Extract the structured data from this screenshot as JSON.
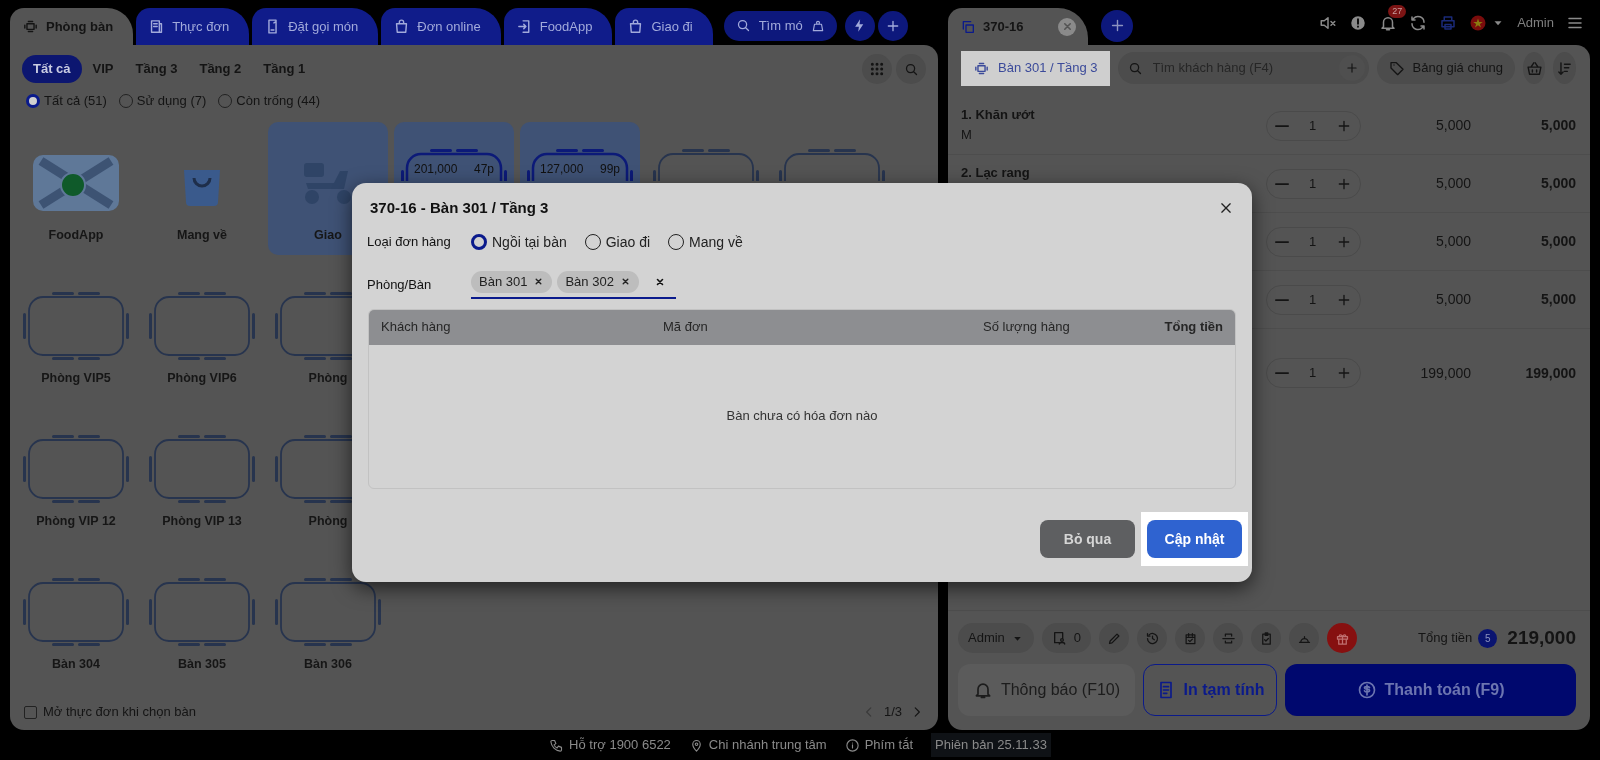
{
  "nav_tabs": [
    {
      "label": "Phòng bàn",
      "selected": true
    },
    {
      "label": "Thực đơn",
      "selected": false
    },
    {
      "label": "Đặt gọi món",
      "selected": false
    },
    {
      "label": "Đơn online",
      "selected": false
    },
    {
      "label": "FoodApp",
      "selected": false
    },
    {
      "label": "Giao đi",
      "selected": false
    }
  ],
  "menu_search": {
    "label": "Tìm mó"
  },
  "area_filters": [
    {
      "label": "Tất cả",
      "selected": true
    },
    {
      "label": "VIP",
      "selected": false
    },
    {
      "label": "Tầng 3",
      "selected": false
    },
    {
      "label": "Tầng 2",
      "selected": false
    },
    {
      "label": "Tầng 1",
      "selected": false
    }
  ],
  "status_filters": [
    {
      "label": "Tất cả (51)",
      "selected": true
    },
    {
      "label": "Sử dụng (7)",
      "selected": false
    },
    {
      "label": "Còn trống (44)",
      "selected": false
    }
  ],
  "table_grid": [
    [
      {
        "kind": "foodapp",
        "label": "FoodApp",
        "selected": false
      },
      {
        "kind": "takeaway",
        "label": "Mang về",
        "selected": false
      },
      {
        "kind": "delivery",
        "label": "Giao",
        "selected": true
      },
      {
        "kind": "table",
        "occupied": true,
        "amount": "201,000",
        "duration": "47p"
      },
      {
        "kind": "table",
        "occupied": true,
        "amount": "127,000",
        "duration": "99p"
      },
      {
        "kind": "table",
        "occupied": false
      },
      {
        "kind": "table",
        "occupied": false
      }
    ],
    [
      {
        "kind": "table",
        "occupied": false,
        "label": "Phòng VIP5"
      },
      {
        "kind": "table",
        "occupied": false,
        "label": "Phòng VIP6"
      },
      {
        "kind": "table",
        "occupied": false,
        "label": "Phòng"
      }
    ],
    [
      {
        "kind": "table",
        "occupied": false,
        "label": "Phòng VIP 12"
      },
      {
        "kind": "table",
        "occupied": false,
        "label": "Phòng VIP 13"
      },
      {
        "kind": "table",
        "occupied": false,
        "label": "Phòng"
      }
    ],
    [
      {
        "kind": "table",
        "occupied": false,
        "label": "Bàn 304"
      },
      {
        "kind": "table",
        "occupied": false,
        "label": "Bàn 305"
      },
      {
        "kind": "table",
        "occupied": false,
        "label": "Bàn 306"
      }
    ]
  ],
  "open_menu_on_select": {
    "label": "Mở thực đơn khi chọn bàn",
    "checked": false
  },
  "pager": {
    "label": "1/3"
  },
  "order_tabs": [
    {
      "label": "370-16",
      "selected": true
    }
  ],
  "notification_count": "27",
  "user": "Admin",
  "order_toolbar": {
    "table": "Bàn 301 / Tầng 3",
    "customer_search": {
      "placeholder": "Tìm khách hàng (F4)"
    },
    "price_list": "Bảng giá chung"
  },
  "order_items": [
    {
      "name": "1. Khăn ướt",
      "note": "M",
      "quantity": "1",
      "price": "5,000",
      "total": "5,000"
    },
    {
      "name": "2. Lạc rang",
      "quantity": "1",
      "price": "5,000",
      "total": "5,000"
    },
    {
      "quantity": "1",
      "price": "5,000",
      "total": "5,000"
    },
    {
      "quantity": "1",
      "price": "5,000",
      "total": "5,000"
    },
    {
      "quantity": "1",
      "price": "199,000",
      "total": "199,000"
    }
  ],
  "order_footer": {
    "staff": "Admin",
    "guests": "0",
    "total_label": "Tổng tiền",
    "item_count": "5",
    "total": "219,000",
    "buttons": [
      {
        "kind": "notify",
        "label": "Thông báo (F10)"
      },
      {
        "kind": "print",
        "label": "In tạm tính"
      },
      {
        "kind": "pay",
        "label": "Thanh toán (F9)"
      }
    ]
  },
  "dialog": {
    "title": "370-16 - Bàn 301 / Tầng 3",
    "order_type_label": "Loại đơn hàng",
    "order_types": [
      {
        "label": "Ngồi tại bàn",
        "selected": true
      },
      {
        "label": "Giao đi",
        "selected": false
      },
      {
        "label": "Mang về",
        "selected": false
      }
    ],
    "table_label": "Phòng/Bàn",
    "selected_tables": [
      "Bàn 301",
      "Bàn 302"
    ],
    "columns": [
      "Khách hàng",
      "Mã đơn",
      "Số lượng hàng",
      "Tổng tiền"
    ],
    "empty_message": "Bàn chưa có hóa đơn nào",
    "buttons": [
      {
        "kind": "secondary",
        "label": "Bỏ qua"
      },
      {
        "kind": "primary",
        "label": "Cập nhật"
      }
    ]
  },
  "status_bar": [
    {
      "kind": "phone",
      "label": "Hỗ trợ 1900 6522"
    },
    {
      "kind": "location",
      "label": "Chi nhánh trung tâm"
    },
    {
      "kind": "info",
      "label": "Phím tắt"
    },
    {
      "kind": "version",
      "label": "Phiên bản 25.11.33"
    }
  ]
}
